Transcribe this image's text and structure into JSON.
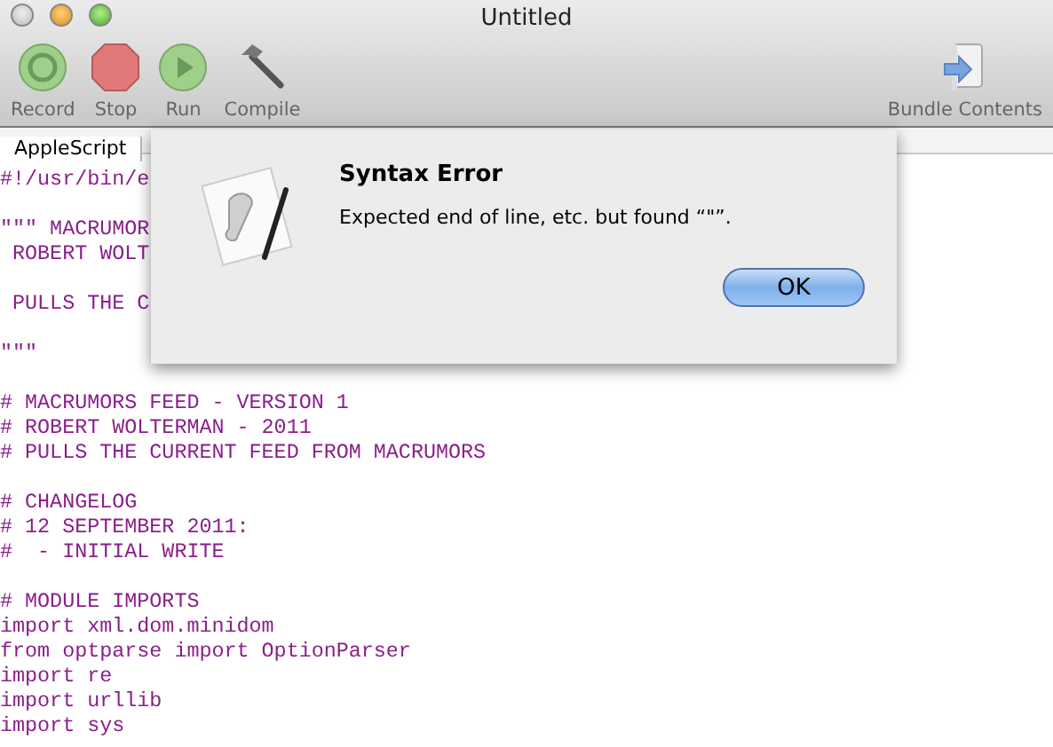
{
  "window": {
    "title": "Untitled"
  },
  "toolbar": [
    {
      "label": "Record",
      "kind": "record"
    },
    {
      "label": "Stop",
      "kind": "stop"
    },
    {
      "label": "Run",
      "kind": "run"
    },
    {
      "label": "Compile",
      "kind": "compile"
    },
    {
      "label": "Bundle Contents",
      "kind": "bundle"
    }
  ],
  "language_tab": {
    "label": "AppleScript"
  },
  "editor": {
    "lines": [
      {
        "kind": "code",
        "text": "#!/usr/bin/e"
      },
      {
        "kind": "blank"
      },
      {
        "kind": "code",
        "text": "\"\"\" MACRUMOR"
      },
      {
        "kind": "code",
        "text": " ROBERT WOLT"
      },
      {
        "kind": "blank"
      },
      {
        "kind": "code",
        "text": " PULLS THE C"
      },
      {
        "kind": "blank"
      },
      {
        "kind": "code",
        "text": "\"\"\""
      },
      {
        "kind": "blank"
      },
      {
        "kind": "code",
        "text": "# MACRUMORS FEED - VERSION 1"
      },
      {
        "kind": "code",
        "text": "# ROBERT WOLTERMAN - 2011"
      },
      {
        "kind": "code",
        "text": "# PULLS THE CURRENT FEED FROM MACRUMORS"
      },
      {
        "kind": "blank"
      },
      {
        "kind": "code",
        "text": "# CHANGELOG"
      },
      {
        "kind": "code",
        "text": "# 12 SEPTEMBER 2011:"
      },
      {
        "kind": "code",
        "text": "#  - INITIAL WRITE"
      },
      {
        "kind": "blank"
      },
      {
        "kind": "code",
        "text": "# MODULE IMPORTS"
      },
      {
        "kind": "code",
        "text": "import xml.dom.minidom"
      },
      {
        "kind": "code",
        "text": "from optparse import OptionParser"
      },
      {
        "kind": "code",
        "text": "import re"
      },
      {
        "kind": "code",
        "text": "import urllib"
      },
      {
        "kind": "code",
        "text": "import sys"
      }
    ]
  },
  "dialog": {
    "title": "Syntax Error",
    "message": "Expected end of line, etc. but found “\"”.",
    "buttons": [
      "OK"
    ]
  }
}
